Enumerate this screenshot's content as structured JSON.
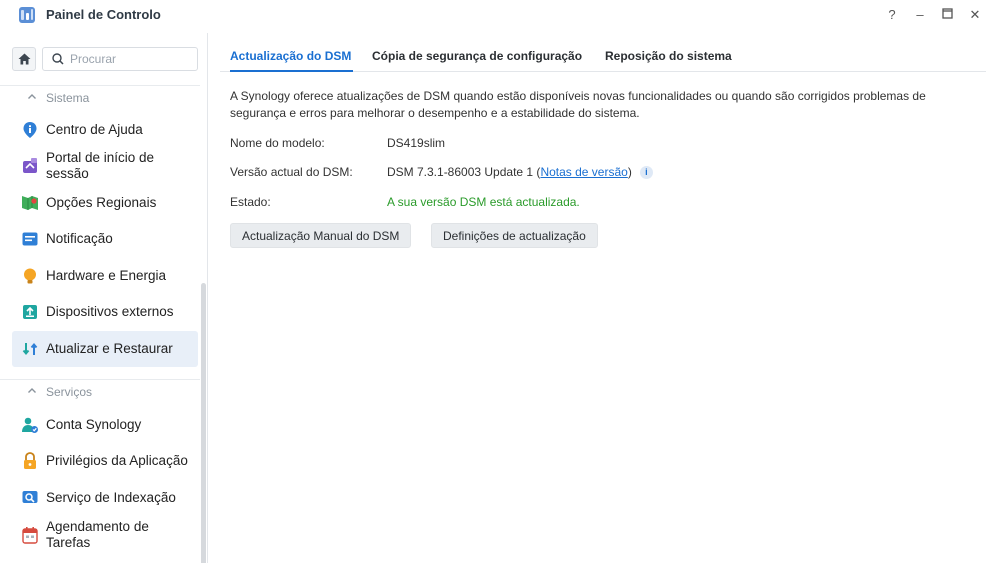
{
  "window": {
    "title": "Painel de Controlo",
    "controls": [
      "?",
      "–",
      "□",
      "✕"
    ]
  },
  "sidebar": {
    "search": {
      "placeholder": "Procurar",
      "value": ""
    },
    "sections": [
      {
        "label": "Sistema"
      },
      {
        "label": "Serviços"
      }
    ],
    "items": [
      {
        "label": "Centro de Ajuda",
        "icon": "help-center-icon"
      },
      {
        "label": "Portal de início de sessão",
        "icon": "login-portal-icon"
      },
      {
        "label": "Opções Regionais",
        "icon": "regional-options-icon"
      },
      {
        "label": "Notificação",
        "icon": "notification-icon"
      },
      {
        "label": "Hardware e Energia",
        "icon": "hardware-power-icon"
      },
      {
        "label": "Dispositivos externos",
        "icon": "external-devices-icon"
      },
      {
        "label": "Atualizar e Restaurar",
        "icon": "update-restore-icon",
        "active": true
      },
      {
        "label": "Conta Synology",
        "icon": "synology-account-icon"
      },
      {
        "label": "Privilégios da Aplicação",
        "icon": "app-privileges-icon"
      },
      {
        "label": "Serviço de Indexação",
        "icon": "indexing-service-icon"
      },
      {
        "label": "Agendamento de Tarefas",
        "icon": "task-scheduler-icon"
      }
    ]
  },
  "main": {
    "tabs": [
      {
        "label": "Actualização do DSM",
        "active": true
      },
      {
        "label": "Cópia de segurança de configuração"
      },
      {
        "label": "Reposição do sistema"
      }
    ],
    "description": "A Synology oferece atualizações de DSM quando estão disponíveis novas funcionalidades ou quando são corrigidos problemas de segurança e erros para melhorar o desempenho e a estabilidade do sistema.",
    "fields": {
      "model_label": "Nome do modelo:",
      "model_value": "DS419slim",
      "version_label": "Versão actual do DSM:",
      "version_value": "DSM 7.3.1-86003 Update 1",
      "version_open": " (",
      "release_notes": "Notas de versão",
      "version_close": ")",
      "status_label": "Estado:",
      "status_value": "A sua versão DSM está actualizada."
    },
    "buttons": {
      "manual_update": "Actualização Manual do DSM",
      "update_settings": "Definições de actualização"
    }
  },
  "colors": {
    "accent": "#1a6fd1",
    "status_ok": "#2a9b2a",
    "active_item_bg": "#e8eff8"
  }
}
